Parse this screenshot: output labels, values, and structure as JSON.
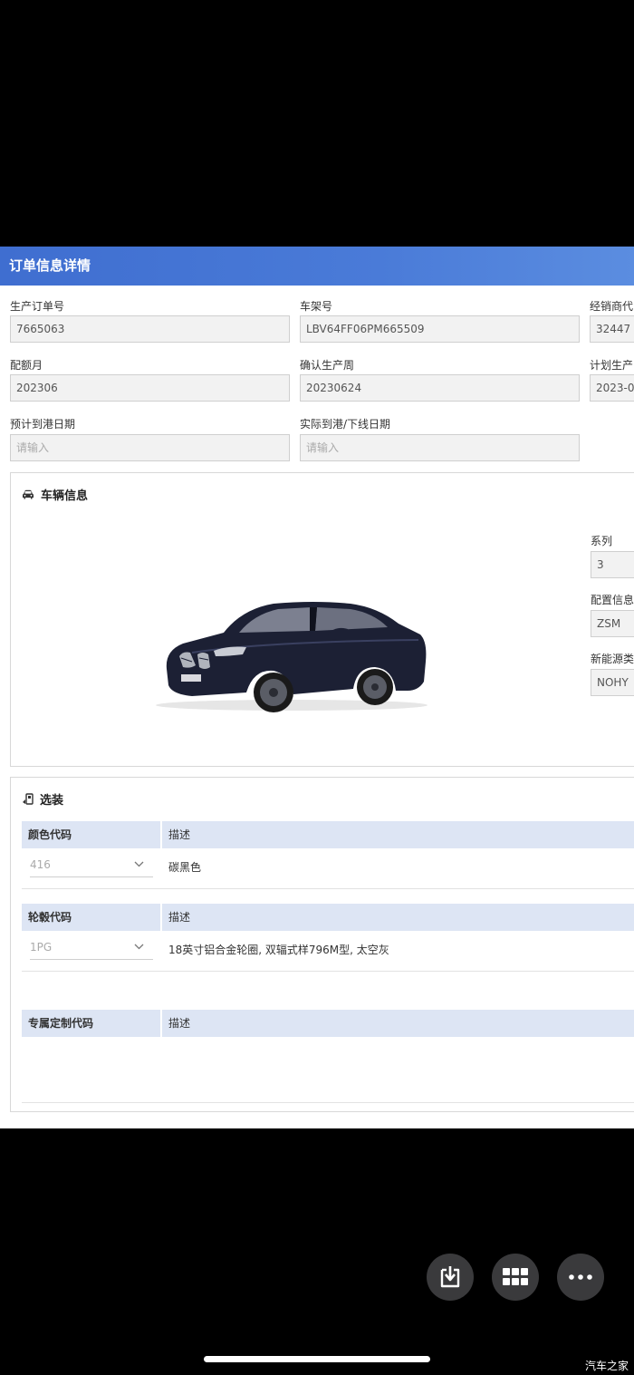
{
  "header": {
    "title": "订单信息详情"
  },
  "order_fields": [
    {
      "label": "生产订单号",
      "value": "7665063"
    },
    {
      "label": "车架号",
      "value": "LBV64FF06PM665509"
    },
    {
      "label": "经销商代",
      "value": "32447"
    },
    {
      "label": "配额月",
      "value": "202306"
    },
    {
      "label": "确认生产周",
      "value": "20230624"
    },
    {
      "label": "计划生产",
      "value": "2023-0"
    },
    {
      "label": "预计到港日期",
      "placeholder": "请输入"
    },
    {
      "label": "实际到港/下线日期",
      "placeholder": "请输入"
    }
  ],
  "vehicle": {
    "title": "车辆信息",
    "fields": [
      {
        "label": "系列",
        "value": "3"
      },
      {
        "label": "配置信息",
        "value": "ZSM"
      },
      {
        "label": "新能源类",
        "value": "NOHY"
      }
    ]
  },
  "options": {
    "title": "选装",
    "tables": [
      {
        "code_header": "颜色代码",
        "desc_header": "描述",
        "rows": [
          {
            "code": "416",
            "desc": "碳黑色"
          }
        ]
      },
      {
        "code_header": "轮毂代码",
        "desc_header": "描述",
        "rows": [
          {
            "code": "1PG",
            "desc": "18英寸铝合金轮圈, 双辐式样796M型, 太空灰"
          }
        ]
      },
      {
        "code_header": "专属定制代码",
        "desc_header": "描述",
        "rows": []
      }
    ]
  },
  "watermark": "汽车之家",
  "colors": {
    "header": "#4a7bd8",
    "table_head": "#dde5f4",
    "car_body": "#1c2034"
  }
}
